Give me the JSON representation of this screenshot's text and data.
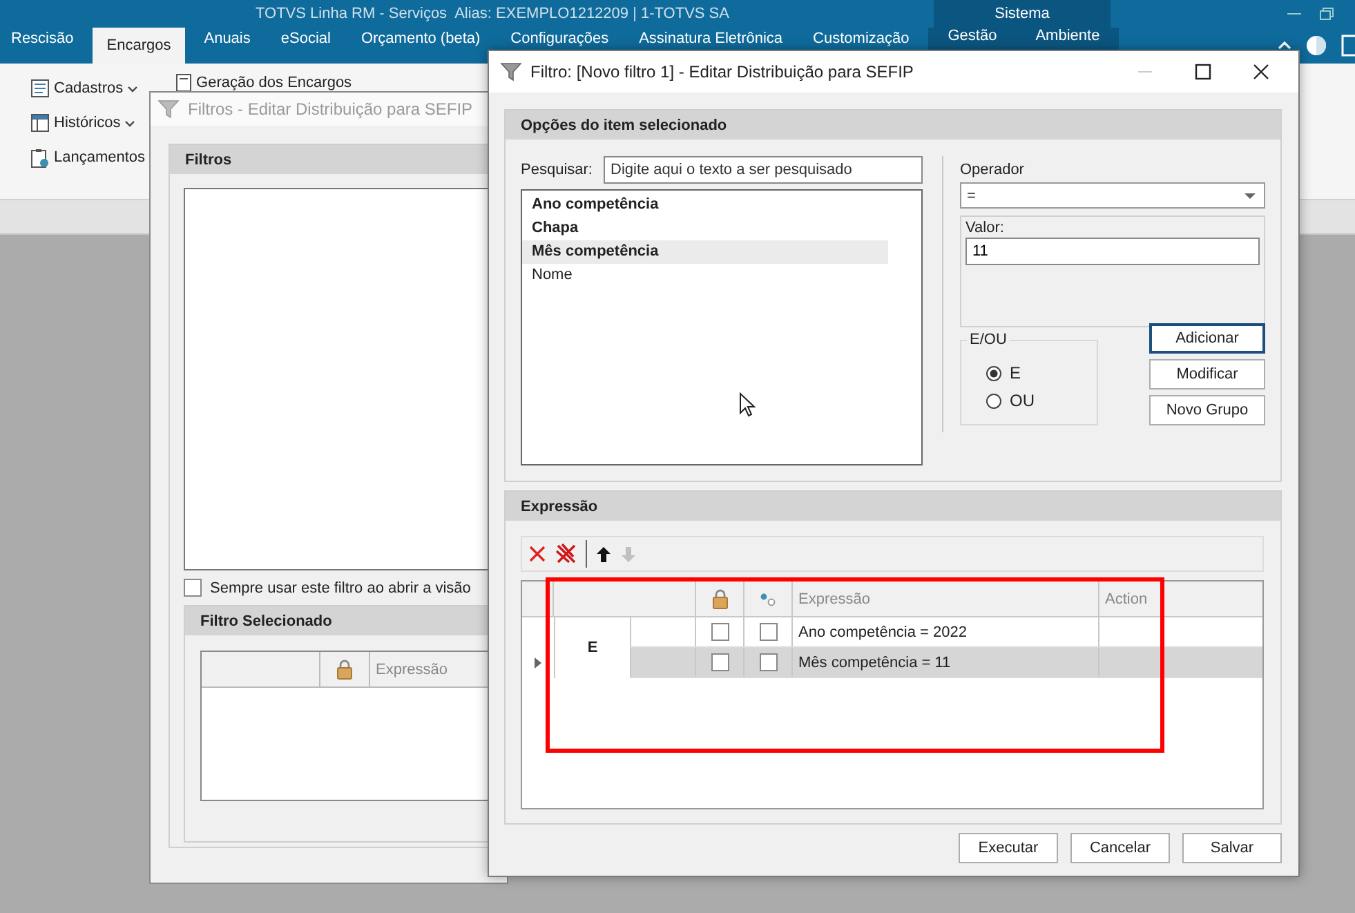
{
  "app": {
    "title": "TOTVS Linha RM - Serviços  Alias: EXEMPLO1212209 | 1-TOTVS SA",
    "context_label": "Sistema"
  },
  "ribbon_tabs": [
    {
      "label": "Rescisão",
      "selected": false,
      "contextual": false
    },
    {
      "label": "Encargos",
      "selected": true,
      "contextual": false
    },
    {
      "label": "Anuais",
      "selected": false,
      "contextual": false
    },
    {
      "label": "eSocial",
      "selected": false,
      "contextual": false
    },
    {
      "label": "Orçamento (beta)",
      "selected": false,
      "contextual": false
    },
    {
      "label": "Configurações",
      "selected": false,
      "contextual": false
    },
    {
      "label": "Assinatura Eletrônica",
      "selected": false,
      "contextual": false
    },
    {
      "label": "Customização",
      "selected": false,
      "contextual": false
    },
    {
      "label": "Gestão",
      "selected": false,
      "contextual": true
    },
    {
      "label": "Ambiente",
      "selected": false,
      "contextual": true
    }
  ],
  "ribbon_items": [
    {
      "kind": "list",
      "label": "Cadastros",
      "dropdown": true
    },
    {
      "kind": "table",
      "label": "Históricos",
      "dropdown": true
    },
    {
      "kind": "clipboard",
      "label": "Lançamentos",
      "dropdown": false
    }
  ],
  "ribbon_items_2": [
    {
      "kind": "calc",
      "label": "Geração dos Encargos",
      "dropdown": false
    }
  ],
  "back_window": {
    "title": "Filtros - Editar Distribuição para SEFIP",
    "filters_header": "Filtros",
    "always_use": {
      "label": "Sempre usar este filtro ao abrir a visão",
      "checked": false
    },
    "selected_header": "Filtro Selecionado",
    "columns": [
      {
        "kind": "blank"
      },
      {
        "kind": "lock"
      },
      {
        "kind": "text",
        "label": "Expressão"
      }
    ]
  },
  "dialog": {
    "title": "Filtro: [Novo filtro 1] - Editar Distribuição para SEFIP",
    "options": {
      "header": "Opções do item selecionado",
      "search_label": "Pesquisar:",
      "search_placeholder": "Digite aqui o texto a ser pesquisado",
      "fields": [
        {
          "label": "Ano competência",
          "bold": true,
          "selected": false
        },
        {
          "label": "Chapa",
          "bold": true,
          "selected": false
        },
        {
          "label": "Mês competência",
          "bold": true,
          "selected": true
        },
        {
          "label": "Nome",
          "bold": false,
          "selected": false
        }
      ],
      "operator_label": "Operador",
      "operator_value": "=",
      "value_label": "Valor:",
      "value": "11",
      "logic": {
        "label": "E/OU",
        "options": [
          {
            "label": "E",
            "selected": true
          },
          {
            "label": "OU",
            "selected": false
          }
        ]
      },
      "buttons": [
        {
          "label": "Adicionar",
          "focused": true
        },
        {
          "label": "Modificar",
          "focused": false
        },
        {
          "label": "Novo Grupo",
          "focused": false
        }
      ]
    },
    "expression": {
      "header": "Expressão",
      "toolbar": [
        {
          "kind": "delete",
          "disabled": false
        },
        {
          "kind": "delete_all",
          "disabled": false
        },
        {
          "kind": "separator"
        },
        {
          "kind": "up",
          "disabled": false
        },
        {
          "kind": "down",
          "disabled": true
        }
      ],
      "columns": [
        {
          "kind": "indicator"
        },
        {
          "kind": "blank"
        },
        {
          "kind": "lock"
        },
        {
          "kind": "link"
        },
        {
          "kind": "text",
          "label": "Expressão"
        },
        {
          "kind": "text",
          "label": "Action"
        }
      ],
      "group_operator": "E",
      "rows": [
        {
          "expression": "Ano competência = 2022",
          "locked": false,
          "linked": false,
          "selected": false
        },
        {
          "expression": "Mês competência = 11",
          "locked": false,
          "linked": false,
          "selected": true
        }
      ],
      "annotation_box": true
    },
    "footer_buttons": [
      "Executar",
      "Cancelar",
      "Salvar"
    ]
  }
}
